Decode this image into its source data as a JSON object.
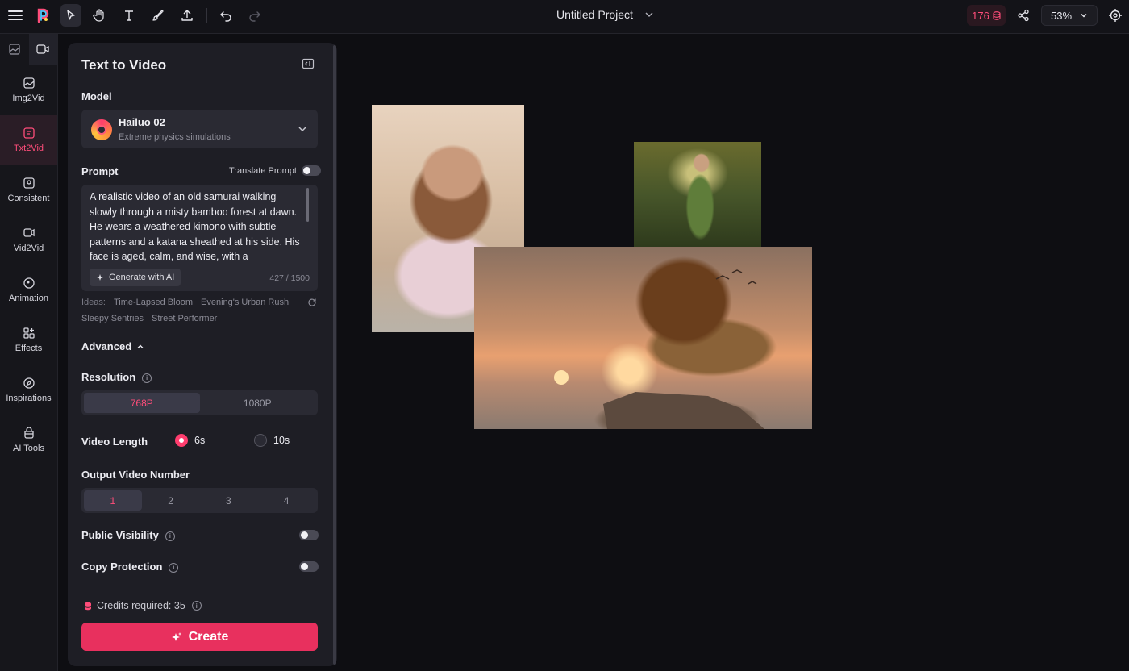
{
  "topbar": {
    "project_title": "Untitled Project",
    "credits": "176",
    "zoom": "53%"
  },
  "rail": {
    "items": [
      {
        "label": "Img2Vid",
        "icon": "image-video-icon"
      },
      {
        "label": "Txt2Vid",
        "icon": "text-video-icon",
        "active": true
      },
      {
        "label": "Consistent",
        "icon": "consistent-icon"
      },
      {
        "label": "Vid2Vid",
        "icon": "video-video-icon"
      },
      {
        "label": "Animation",
        "icon": "animation-icon"
      },
      {
        "label": "Effects",
        "icon": "effects-icon"
      },
      {
        "label": "Inspirations",
        "icon": "compass-icon"
      },
      {
        "label": "AI Tools",
        "icon": "ai-tools-icon"
      }
    ]
  },
  "panel": {
    "title": "Text to Video",
    "model_label": "Model",
    "model_name": "Hailuo 02",
    "model_desc": "Extreme physics simulations",
    "prompt_label": "Prompt",
    "translate_label": "Translate Prompt",
    "prompt_text": "A realistic video of an old samurai walking slowly through a misty bamboo forest at dawn. He wears a weathered kimono with subtle patterns and a katana sheathed at his side. His face is aged, calm, and wise, with a",
    "generate_ai": "Generate with AI",
    "char_count": "427 / 1500",
    "ideas_label": "Ideas:",
    "ideas": [
      "Time-Lapsed Bloom",
      "Evening's Urban Rush",
      "Sleepy Sentries",
      "Street Performer"
    ],
    "advanced_label": "Advanced",
    "resolution_label": "Resolution",
    "resolutions": [
      "768P",
      "1080P"
    ],
    "video_length_label": "Video Length",
    "lengths": [
      "6s",
      "10s"
    ],
    "output_number_label": "Output Video Number",
    "output_numbers": [
      "1",
      "2",
      "3",
      "4"
    ],
    "public_visibility_label": "Public Visibility",
    "copy_protection_label": "Copy Protection",
    "credits_required": "Credits required: 35",
    "create_label": "Create"
  },
  "colors": {
    "accent": "#e8305e",
    "accent_text": "#ff4d7a",
    "panel_bg": "#1e1e25",
    "canvas_bg": "#0e0e12"
  }
}
